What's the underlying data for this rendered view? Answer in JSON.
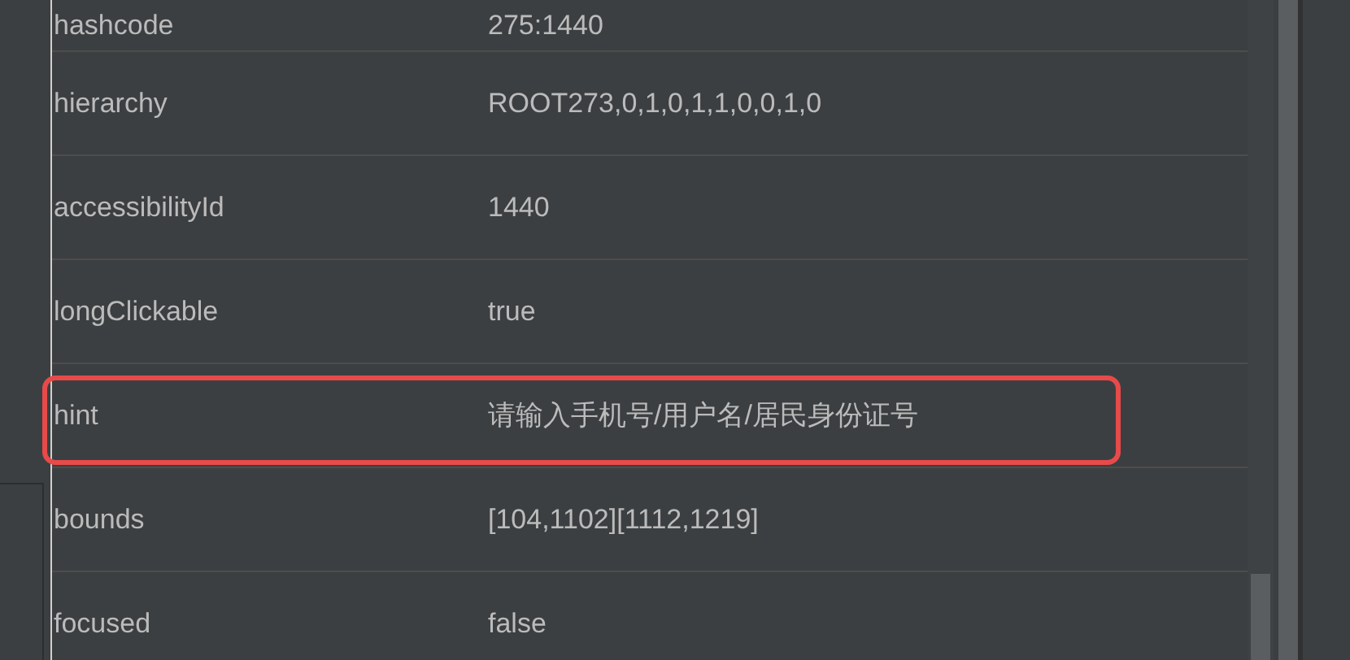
{
  "properties": [
    {
      "name": "hashcode",
      "value": "275:1440",
      "highlighted": false
    },
    {
      "name": "hierarchy",
      "value": "ROOT273,0,1,0,1,1,0,0,1,0",
      "highlighted": false
    },
    {
      "name": "accessibilityId",
      "value": "1440",
      "highlighted": false
    },
    {
      "name": "longClickable",
      "value": "true",
      "highlighted": false
    },
    {
      "name": "hint",
      "value": "请输入手机号/用户名/居民身份证号",
      "highlighted": true
    },
    {
      "name": "bounds",
      "value": "[104,1102][1112,1219]",
      "highlighted": false
    },
    {
      "name": "focused",
      "value": "false",
      "highlighted": false
    }
  ]
}
